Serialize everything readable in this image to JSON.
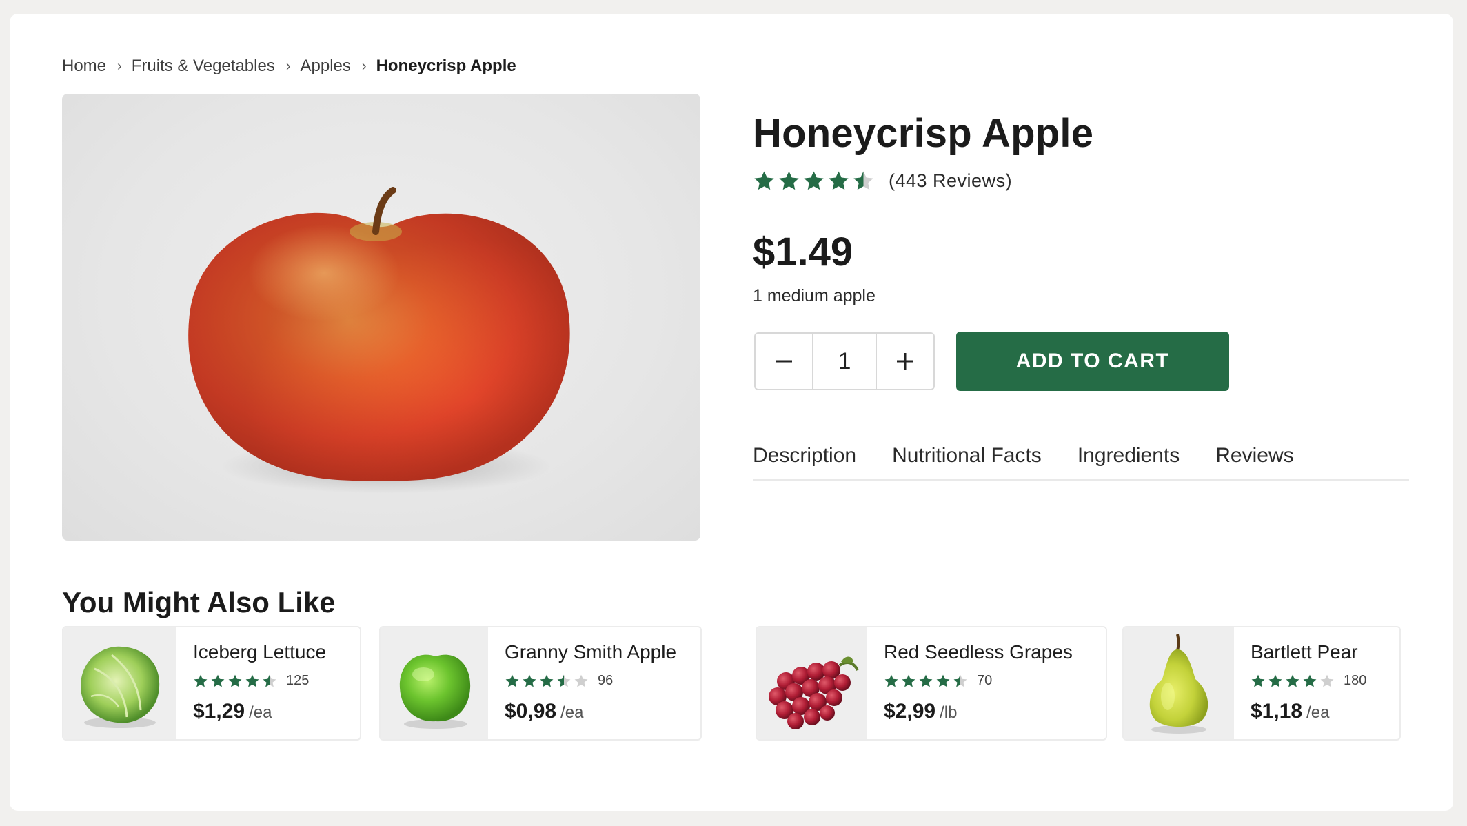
{
  "breadcrumb": {
    "items": [
      "Home",
      "Fruits & Vegetables",
      "Apples",
      "Honeycrisp Apple"
    ]
  },
  "product": {
    "title": "Honeycrisp Apple",
    "rating": 4.5,
    "review_count": "(443 Reviews)",
    "price": "$1.49",
    "unit": "1 medium apple",
    "quantity": "1",
    "add_to_cart": "ADD TO CART",
    "image_icon": "apple-photo"
  },
  "tabs": [
    "Description",
    "Nutritional Facts",
    "Ingredients",
    "Reviews"
  ],
  "recommendations": {
    "heading": "You Might Also Like",
    "items": [
      {
        "name": "Iceberg Lettuce",
        "rating": 4.5,
        "count": "125",
        "price": "$1,29",
        "per": "/ea",
        "image_icon": "lettuce-photo"
      },
      {
        "name": "Granny Smith Apple",
        "rating": 3.5,
        "count": "96",
        "price": "$0,98",
        "per": "/ea",
        "image_icon": "green-apple-photo"
      },
      {
        "name": "Red Seedless Grapes",
        "rating": 4.5,
        "count": "70",
        "price": "$2,99",
        "per": "/lb",
        "image_icon": "grapes-photo"
      },
      {
        "name": "Bartlett Pear",
        "rating": 4,
        "count": "180",
        "price": "$1,18",
        "per": "/ea",
        "image_icon": "pear-photo"
      }
    ]
  },
  "colors": {
    "accent": "#256c46",
    "star": "#256c46",
    "star_empty": "#cfcfcf"
  }
}
